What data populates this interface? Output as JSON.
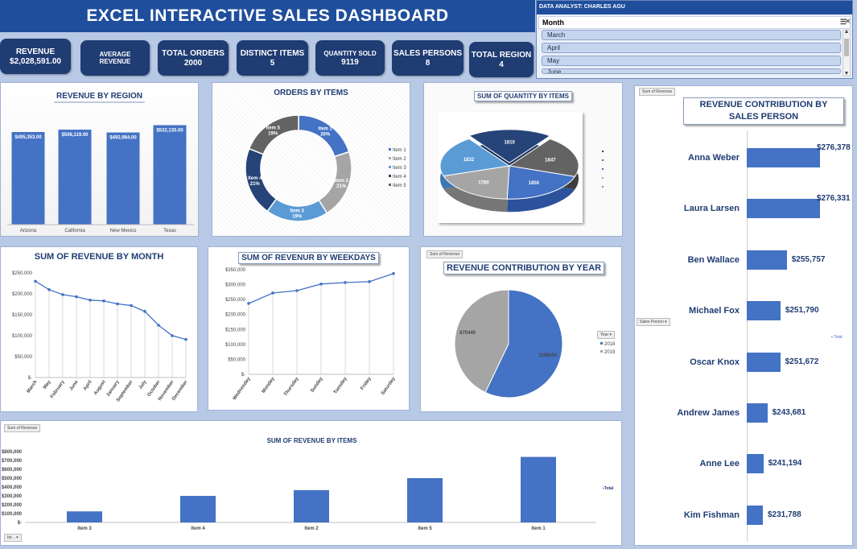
{
  "title": "EXCEL INTERACTIVE SALES DASHBOARD",
  "slicer": {
    "analyst": "DATA ANALYST: CHARLES AGU",
    "header": "Month",
    "items": [
      "March",
      "April",
      "May",
      "June"
    ],
    "icons": [
      "multi-select-icon",
      "clear-filter-icon"
    ]
  },
  "kpis": [
    {
      "label": "REVENUE",
      "value": "$2,028,591.00"
    },
    {
      "label": "AVERAGE REVENUE",
      "value": ""
    },
    {
      "label": "TOTAL ORDERS",
      "value": "2000"
    },
    {
      "label": "DISTINCT ITEMS",
      "value": "5"
    },
    {
      "label": "QUANTITY SOLD",
      "value": "9119"
    },
    {
      "label": "SALES PERSONS",
      "value": "8"
    },
    {
      "label": "TOTAL REGION",
      "value": "4"
    }
  ],
  "pivot_labels": {
    "sum_of_revenue": "Sum of Revenue",
    "sales_person": "Sales Person",
    "year": "Year",
    "item": "Ite...",
    "total": "Total"
  },
  "colors": {
    "accent": "#4472c4",
    "navy": "#1f3c73",
    "banner": "#1f4e9d",
    "grey": "#a5a5a5",
    "dark": "#264478"
  },
  "chart_data": [
    {
      "id": "region",
      "type": "bar",
      "title": "REVENUE BY REGION",
      "categories": [
        "Arizona",
        "California",
        "New Mexico",
        "Texas"
      ],
      "values": [
        495353,
        508119,
        492984,
        532135
      ],
      "labels": [
        "$495,353.00",
        "$508,119.00",
        "$492,984.00",
        "$532,135.00"
      ]
    },
    {
      "id": "items_orders",
      "type": "pie",
      "title": "ORDERS BY ITEMS",
      "categories": [
        "Item 1",
        "Item 2",
        "Item 3",
        "Item 4",
        "Item 5"
      ],
      "values": [
        20,
        21,
        19,
        21,
        19
      ],
      "labels": [
        "20%",
        "21%",
        "19%",
        "21%",
        "19%"
      ],
      "colors": [
        "#4472c4",
        "#a5a5a5",
        "#5b9bd5",
        "#264478",
        "#636363"
      ]
    },
    {
      "id": "quantity",
      "type": "pie",
      "title": "SUM OF QUANTITY BY ITEMS",
      "values": [
        1810,
        1847,
        1850,
        1780,
        1832
      ],
      "labels": [
        "1810",
        "1847",
        "1850",
        "1780",
        "1832"
      ],
      "colors": [
        "#264478",
        "#636363",
        "#4472c4",
        "#a5a5a5",
        "#5b9bd5"
      ]
    },
    {
      "id": "month",
      "type": "line",
      "title": "SUM OF REVENUE BY MONTH",
      "categories": [
        "March",
        "May",
        "February",
        "June",
        "April",
        "August",
        "January",
        "September",
        "July",
        "October",
        "November",
        "December"
      ],
      "values": [
        230000,
        210000,
        198000,
        193000,
        185000,
        183000,
        176000,
        172000,
        158000,
        125000,
        100000,
        91000
      ],
      "ylim": [
        0,
        250000
      ],
      "yticks": [
        "$-",
        "$50,000",
        "$100,000",
        "$150,000",
        "$200,000",
        "$250,000"
      ]
    },
    {
      "id": "weekday",
      "type": "line",
      "title": "SUM OF REVENUR BY WEEKDAYS",
      "categories": [
        "Wednesday",
        "Monday",
        "Thursday",
        "Sunday",
        "Tuesday",
        "Friday",
        "Saturday"
      ],
      "values": [
        237000,
        272000,
        280000,
        302000,
        307000,
        310000,
        337000
      ],
      "ylim": [
        0,
        350000
      ],
      "yticks": [
        "$-",
        "$50,000",
        "$100,000",
        "$150,000",
        "$200,000",
        "$250,000",
        "$300,000",
        "$350,000"
      ]
    },
    {
      "id": "year",
      "type": "pie",
      "title": "REVENUE CONTRIBUTION BY YEAR",
      "categories": [
        "2018",
        "2019"
      ],
      "values": [
        1158151,
        870440
      ],
      "labels": [
        "1158151",
        "870440"
      ],
      "colors": [
        "#4472c4",
        "#a5a5a5"
      ]
    },
    {
      "id": "items_rev",
      "type": "bar",
      "title": "SUM OF REVENUE BY ITEMS",
      "categories": [
        "Item 3",
        "Item 4",
        "Item 2",
        "Item 5",
        "Item 1"
      ],
      "values": [
        125000,
        300000,
        365000,
        500000,
        740000
      ],
      "ylim": [
        0,
        800000
      ],
      "yticks": [
        "$-",
        "$100,000",
        "$200,000",
        "$300,000",
        "$400,000",
        "$500,000",
        "$600,000",
        "$700,000",
        "$800,000"
      ]
    },
    {
      "id": "salesperson",
      "type": "bar",
      "title": "REVENUE CONTRIBUTION BY SALES PERSON",
      "categories": [
        "Anna Weber",
        "Laura Larsen",
        "Ben Wallace",
        "Michael Fox",
        "Oscar Knox",
        "Andrew James",
        "Anne Lee",
        "Kim Fishman"
      ],
      "values": [
        276378,
        276331,
        255757,
        251790,
        251672,
        243681,
        241194,
        231788
      ],
      "labels": [
        "$276,378",
        "$276,331",
        "$255,757",
        "$251,790",
        "$251,672",
        "$243,681",
        "$241,194",
        "$231,788"
      ]
    }
  ]
}
